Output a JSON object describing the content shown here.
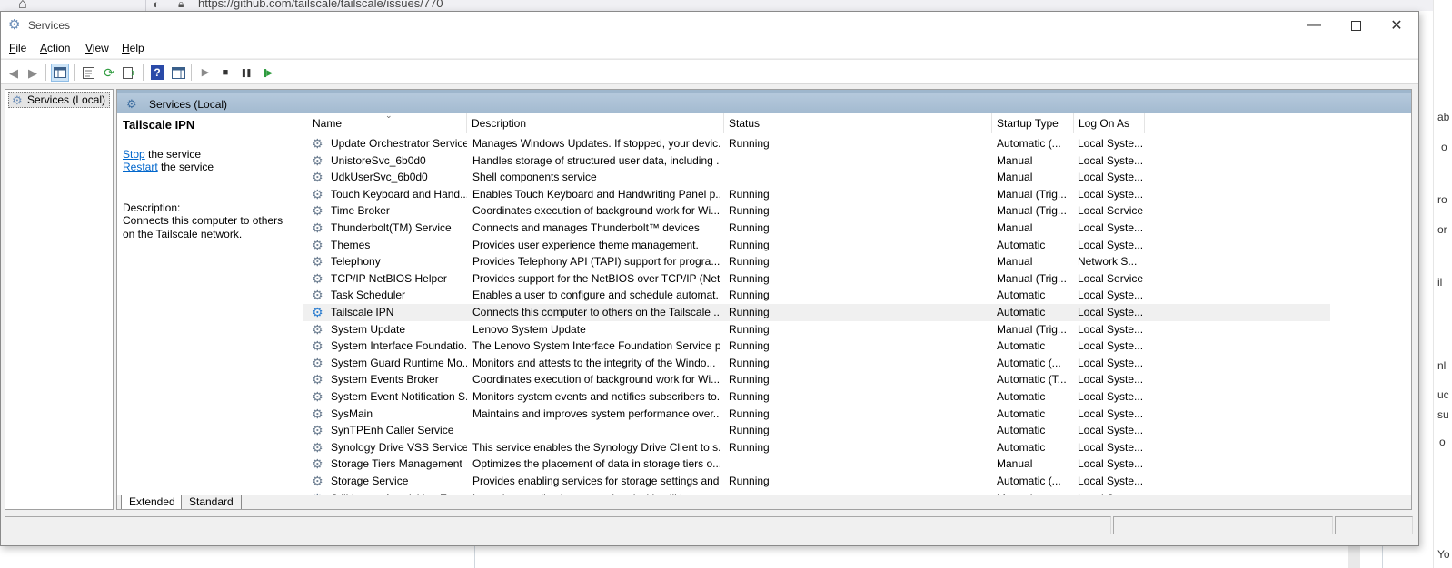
{
  "background": {
    "url": "https://github.com/tailscale/tailscale/issues/770",
    "right_fragments": [
      "ab",
      "o",
      "ro",
      "or",
      "il",
      "nl",
      "uc",
      "su",
      "o",
      "Yo"
    ]
  },
  "window": {
    "title": "Services",
    "controls": {
      "minimize": "—",
      "maximize": "",
      "close": "✕"
    }
  },
  "menu": [
    {
      "key": "F",
      "rest": "ile"
    },
    {
      "key": "A",
      "rest": "ction"
    },
    {
      "key": "V",
      "rest": "iew"
    },
    {
      "key": "H",
      "rest": "elp"
    }
  ],
  "tree": {
    "root_label": "Services (Local)"
  },
  "header": {
    "title": "Services (Local)"
  },
  "extended": {
    "service_name": "Tailscale IPN",
    "stop_link": "Stop",
    "stop_rest": " the service",
    "restart_link": "Restart",
    "restart_rest": " the service",
    "description_label": "Description:",
    "description_text": "Connects this computer to others on the Tailscale network."
  },
  "columns": {
    "name": "Name",
    "description": "Description",
    "status": "Status",
    "startup": "Startup Type",
    "logon": "Log On As"
  },
  "services": [
    {
      "name": "Update Orchestrator Service",
      "description": "Manages Windows Updates. If stopped, your devic...",
      "status": "Running",
      "startup": "Automatic (...",
      "logon": "Local Syste..."
    },
    {
      "name": "UnistoreSvc_6b0d0",
      "description": "Handles storage of structured user data, including ...",
      "status": "",
      "startup": "Manual",
      "logon": "Local Syste..."
    },
    {
      "name": "UdkUserSvc_6b0d0",
      "description": "Shell components service",
      "status": "",
      "startup": "Manual",
      "logon": "Local Syste..."
    },
    {
      "name": "Touch Keyboard and Hand...",
      "description": "Enables Touch Keyboard and Handwriting Panel p...",
      "status": "Running",
      "startup": "Manual (Trig...",
      "logon": "Local Syste..."
    },
    {
      "name": "Time Broker",
      "description": "Coordinates execution of background work for Wi...",
      "status": "Running",
      "startup": "Manual (Trig...",
      "logon": "Local Service"
    },
    {
      "name": "Thunderbolt(TM) Service",
      "description": "Connects and manages Thunderbolt™ devices",
      "status": "Running",
      "startup": "Manual",
      "logon": "Local Syste..."
    },
    {
      "name": "Themes",
      "description": "Provides user experience theme management.",
      "status": "Running",
      "startup": "Automatic",
      "logon": "Local Syste..."
    },
    {
      "name": "Telephony",
      "description": "Provides Telephony API (TAPI) support for progra...",
      "status": "Running",
      "startup": "Manual",
      "logon": "Network S..."
    },
    {
      "name": "TCP/IP NetBIOS Helper",
      "description": "Provides support for the NetBIOS over TCP/IP (Net...",
      "status": "Running",
      "startup": "Manual (Trig...",
      "logon": "Local Service"
    },
    {
      "name": "Task Scheduler",
      "description": "Enables a user to configure and schedule automat...",
      "status": "Running",
      "startup": "Automatic",
      "logon": "Local Syste..."
    },
    {
      "name": "Tailscale IPN",
      "description": "Connects this computer to others on the Tailscale ...",
      "status": "Running",
      "startup": "Automatic",
      "logon": "Local Syste...",
      "selected": true
    },
    {
      "name": "System Update",
      "description": "Lenovo System Update",
      "status": "Running",
      "startup": "Manual (Trig...",
      "logon": "Local Syste..."
    },
    {
      "name": "System Interface Foundatio...",
      "description": "The Lenovo System Interface Foundation Service p...",
      "status": "Running",
      "startup": "Automatic",
      "logon": "Local Syste..."
    },
    {
      "name": "System Guard Runtime Mo...",
      "description": "Monitors and attests to the integrity of the Windo...",
      "status": "Running",
      "startup": "Automatic (...",
      "logon": "Local Syste..."
    },
    {
      "name": "System Events Broker",
      "description": "Coordinates execution of background work for Wi...",
      "status": "Running",
      "startup": "Automatic (T...",
      "logon": "Local Syste..."
    },
    {
      "name": "System Event Notification S...",
      "description": "Monitors system events and notifies subscribers to...",
      "status": "Running",
      "startup": "Automatic",
      "logon": "Local Syste..."
    },
    {
      "name": "SysMain",
      "description": "Maintains and improves system performance over...",
      "status": "Running",
      "startup": "Automatic",
      "logon": "Local Syste..."
    },
    {
      "name": "SynTPEnh Caller Service",
      "description": "",
      "status": "Running",
      "startup": "Automatic",
      "logon": "Local Syste..."
    },
    {
      "name": "Synology Drive VSS Service ...",
      "description": "This service enables the Synology Drive Client to s...",
      "status": "Running",
      "startup": "Automatic",
      "logon": "Local Syste..."
    },
    {
      "name": "Storage Tiers Management",
      "description": "Optimizes the placement of data in storage tiers o...",
      "status": "",
      "startup": "Manual",
      "logon": "Local Syste..."
    },
    {
      "name": "Storage Service",
      "description": "Provides enabling services for storage settings and...",
      "status": "Running",
      "startup": "Automatic (...",
      "logon": "Local Syste..."
    },
    {
      "name": "Still Image Acquisition Events",
      "description": "Launches applications associated with still image ...",
      "status": "",
      "startup": "Manual",
      "logon": "Local Syste..."
    }
  ],
  "tabs": [
    "Extended",
    "Standard"
  ],
  "icons": {
    "gear": "⚙",
    "back": "◀",
    "forward": "▶",
    "play": "▶",
    "stop": "■",
    "pause": "❚❚",
    "restart": "❚▶",
    "help": "?"
  },
  "colors": {
    "header_band": "#a3bad0",
    "link": "#0066cc",
    "selected_row": "#f0f0f0"
  }
}
